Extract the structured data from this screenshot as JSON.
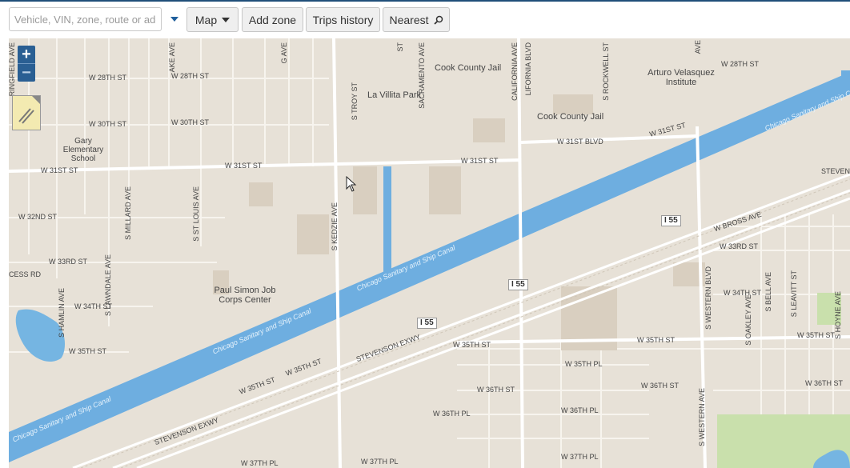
{
  "toolbar": {
    "search_placeholder": "Vehicle, VIN, zone, route or address",
    "map_label": "Map",
    "add_zone_label": "Add zone",
    "trips_history_label": "Trips history",
    "nearest_label": "Nearest"
  },
  "map": {
    "zoom_in": "+",
    "zoom_out": "−",
    "streets_h": [
      "W 28TH ST",
      "W 28TH ST",
      "W 28TH ST",
      "W 30TH ST",
      "W 30TH ST",
      "W 31ST ST",
      "W 31ST ST",
      "W 31ST ST",
      "W 31ST BLVD",
      "W 31ST ST",
      "W 32ND ST",
      "W 33RD ST",
      "CESS RD",
      "W 34TH ST",
      "W 35TH ST",
      "W 35TH ST",
      "W 35TH ST",
      "W 35TH PL",
      "W 36TH ST",
      "W 36TH PL",
      "W 36TH PL",
      "W 35TH ST",
      "W 35TH ST",
      "W 36TH ST",
      "W 37TH PL",
      "W 37TH PL",
      "W 37TH PL",
      "W BROSS AVE",
      "W 33RD ST",
      "W 34TH ST",
      "W 35TH ST",
      "W 36TH ST",
      "STEVEN"
    ],
    "streets_v": [
      "RINGFIELD AVE",
      "AKE AVE",
      "G AVE",
      "S TROY ST",
      "SACRAMENTO AVE",
      "LIFORNIA BLVD",
      "S ROCKWELL ST",
      "AVE",
      "S MILLARD AVE",
      "S ST LOUIS AVE",
      "S KEDZIE AVE",
      "CALIFORNIA AVE",
      "S LAWNDALE AVE",
      "S HAMLIN AVE",
      "S WESTERN BLVD",
      "S WESTERN AVE",
      "S OAKLEY AVE",
      "S BELL AVE",
      "S LEAVITT ST",
      "S HOYNE AVE",
      "ST"
    ],
    "places": [
      "Cook County Jail",
      "La Villita Park",
      "Arturo Velasquez Institute",
      "Cook County Jail",
      "Gary Elementary School",
      "Paul Simon Job Corps Center"
    ],
    "highways": [
      "I 55",
      "I 55",
      "I 55"
    ],
    "expressways": [
      "STEVENSON EXWY",
      "STEVENSON EXWY"
    ],
    "canal": "Chicago Sanitary and Ship Canal"
  }
}
